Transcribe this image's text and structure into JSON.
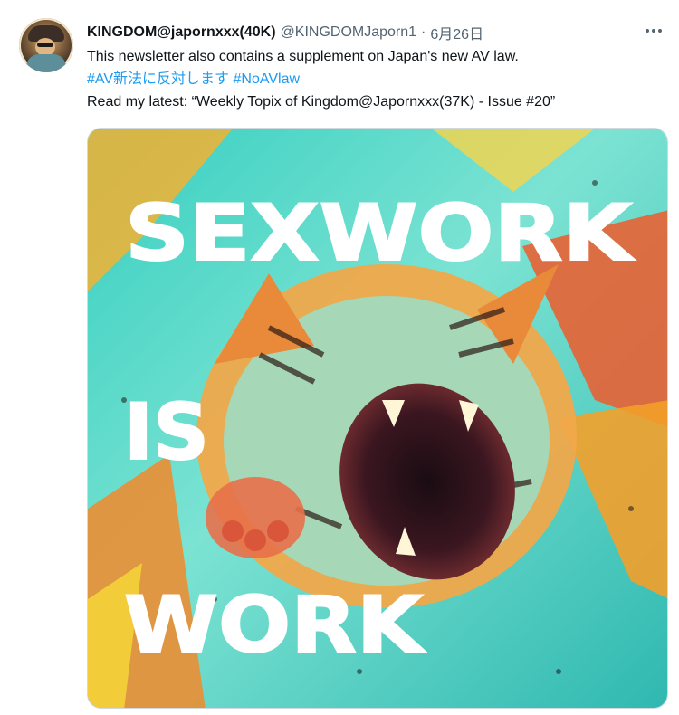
{
  "tweet": {
    "display_name": "KINGDOM@japornxxx(40K)",
    "handle": "@KINGDOMJaporn1",
    "separator": "·",
    "date": "6月26日",
    "lines": {
      "line1": "This newsletter also contains a supplement on Japan's new AV law.",
      "hashtag1": "#AV新法に反対します",
      "hashtag2": "#NoAVlaw",
      "line3": "Read my latest: “Weekly Topix of Kingdom@Japornxxx(37K) - Issue #20”"
    },
    "media": {
      "words": [
        "SEXWORK",
        "IS",
        "WORK"
      ]
    }
  },
  "colors": {
    "text": "#0f1419",
    "secondary": "#536471",
    "link": "#1d9bf0"
  }
}
